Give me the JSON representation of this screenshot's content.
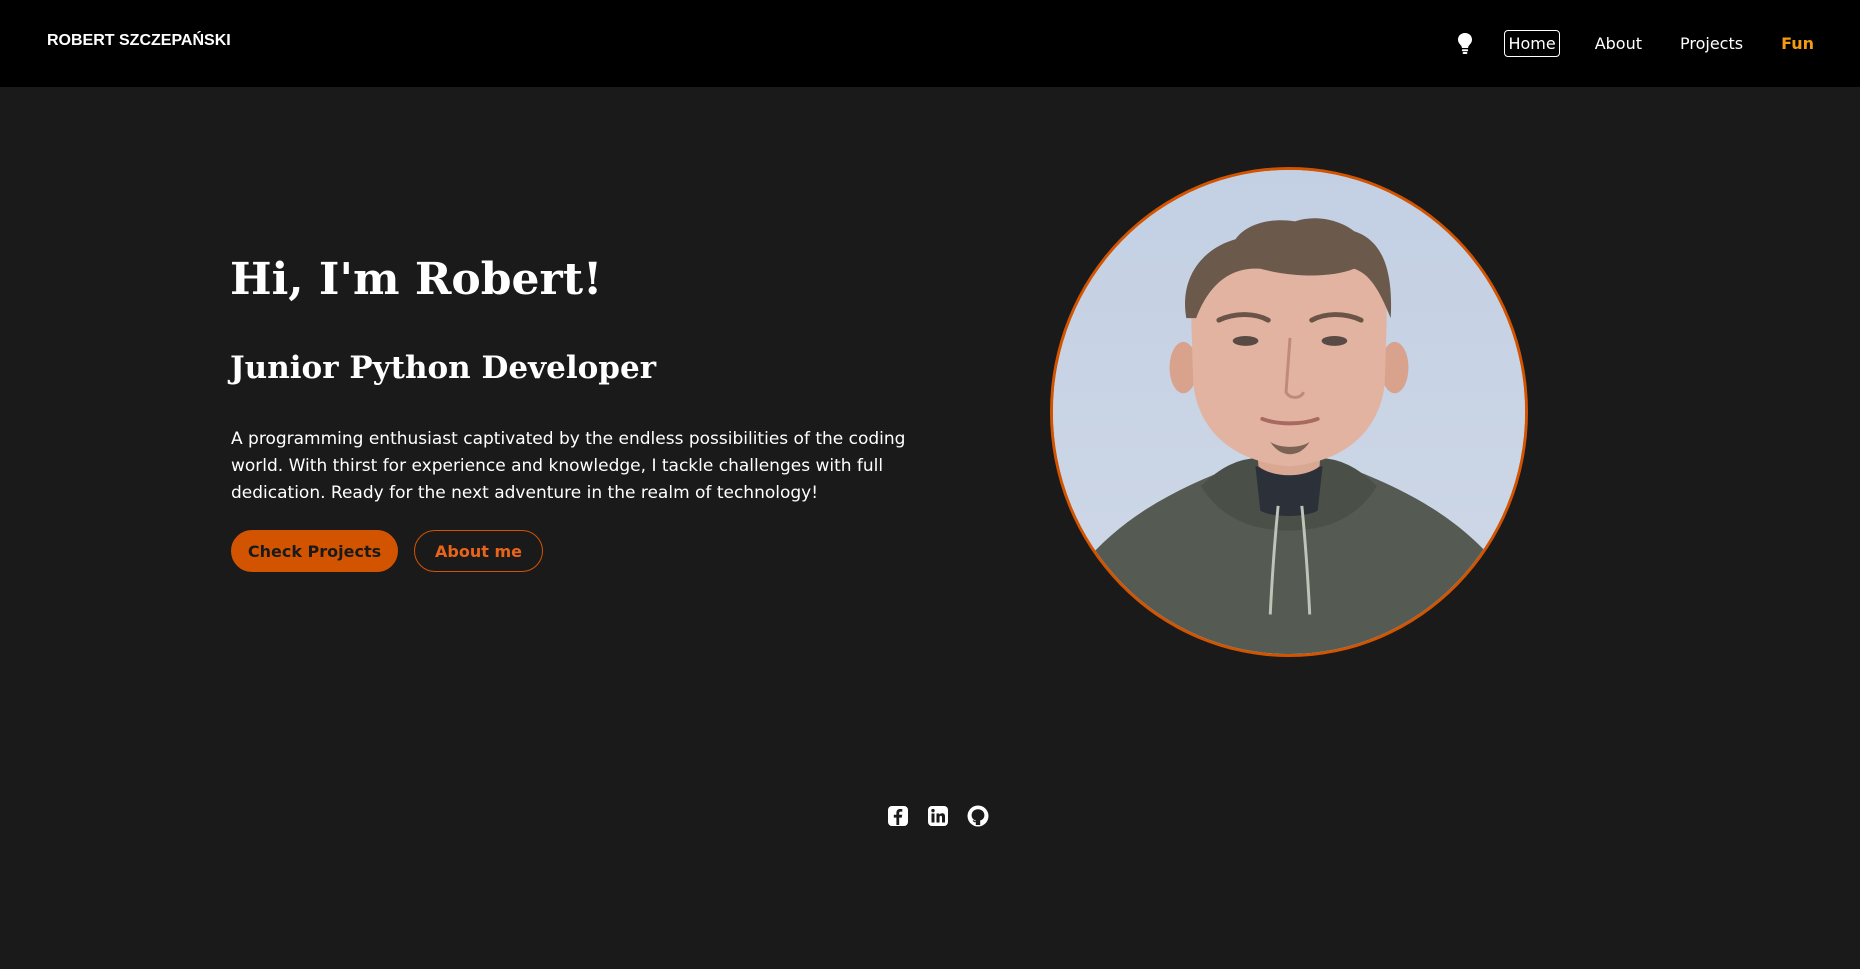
{
  "brand": {
    "name": "ROBERT SZCZEPAŃSKI"
  },
  "nav": {
    "theme_toggle_icon": "lightbulb-icon",
    "items": [
      {
        "label": "Home",
        "active": true
      },
      {
        "label": "About"
      },
      {
        "label": "Projects"
      },
      {
        "label": "Fun"
      }
    ]
  },
  "hero": {
    "title": "Hi, I'm Robert!",
    "subtitle": "Junior Python Developer",
    "description": "A programming enthusiast captivated by the endless possibilities of the coding world. With thirst for experience and knowledge, I tackle challenges with full dedication. Ready for the next adventure in the realm of technology!",
    "primary_button": "Check Projects",
    "secondary_button": "About me"
  },
  "socials": [
    {
      "icon": "facebook-icon"
    },
    {
      "icon": "linkedin-icon"
    },
    {
      "icon": "github-icon"
    }
  ],
  "colors": {
    "accent": "#d35400",
    "fun_link": "#f39c12",
    "background": "#1a1a1a",
    "navbar": "#000000"
  }
}
